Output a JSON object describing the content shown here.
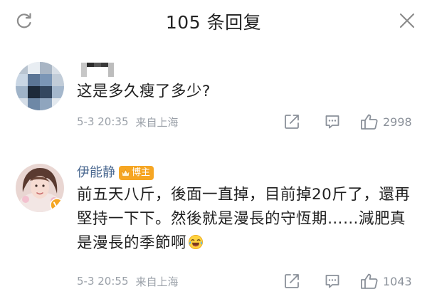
{
  "header": {
    "title": "105 条回复"
  },
  "comments": [
    {
      "username": "",
      "text": "这是多久瘦了多少?",
      "time": "5-3 20:35",
      "location": "来自上海",
      "likes": "2998"
    },
    {
      "username": "伊能静",
      "badge": "博主",
      "text": "前五天八斤，後面一直掉，目前掉20斤了，還再堅持一下下。然後就是漫長的守恆期……減肥真是漫長的季節啊",
      "time": "5-3 20:55",
      "location": "来自上海",
      "likes": "1043"
    }
  ],
  "icons": {
    "refresh": "refresh-icon",
    "close": "close-icon",
    "share": "share-icon",
    "reply": "comment-icon",
    "like": "thumbs-up-icon",
    "emoji": "laughing-tears-emoji",
    "badge": "vip-crown-icon"
  },
  "colors": {
    "username": "#4a6890",
    "meta": "#9aa0a8",
    "badge": "#f6a623"
  }
}
